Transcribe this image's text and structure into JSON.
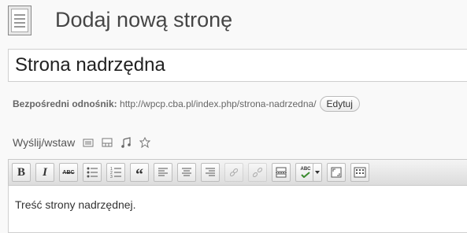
{
  "header": {
    "title": "Dodaj nową stronę"
  },
  "post_title": {
    "value": "Strona nadrzędna"
  },
  "permalink": {
    "label": "Bezpośredni odnośnik:",
    "url": "http://wpcp.cba.pl/index.php/strona-nadrzedna/",
    "edit_label": "Edytuj"
  },
  "media": {
    "label": "Wyślij/wstaw"
  },
  "toolbar": {
    "bold": "B",
    "italic": "I",
    "strike": "ABC",
    "quote": "“",
    "spell": "ABC"
  },
  "editor": {
    "content": "Treść strony nadrzędnej."
  }
}
